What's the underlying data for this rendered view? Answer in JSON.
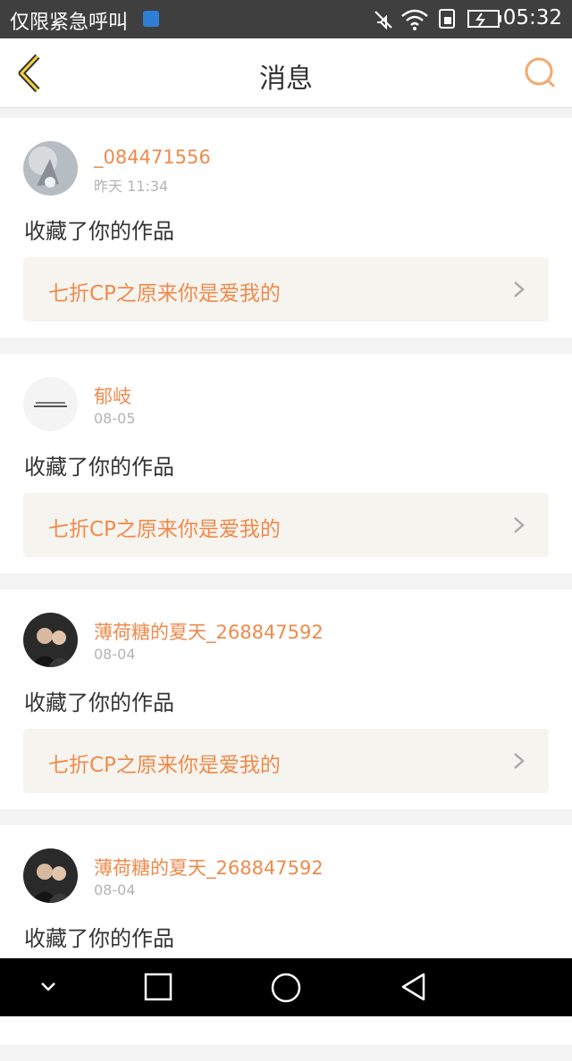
{
  "status_bar": {
    "carrier": "仅限紧急呼叫",
    "time": "05:32"
  },
  "header": {
    "title": "消息"
  },
  "messages": [
    {
      "user": "_084471556",
      "time": "昨天 11:34",
      "action": "收藏了你的作品",
      "work_title": "七折CP之原来你是爱我的"
    },
    {
      "user": "郁岐",
      "time": "08-05",
      "action": "收藏了你的作品",
      "work_title": "七折CP之原来你是爱我的"
    },
    {
      "user": "薄荷糖的夏天_268847592",
      "time": "08-04",
      "action": "收藏了你的作品",
      "work_title": "七折CP之原来你是爱我的"
    },
    {
      "user": "薄荷糖的夏天_268847592",
      "time": "08-04",
      "action": "收藏了你的作品",
      "work_title": ""
    }
  ],
  "colors": {
    "accent": "#f08a4b",
    "status_bar": "#3f3f3f",
    "card_bg": "#ffffff",
    "work_bg": "#f5f4ef",
    "page_bg": "#f3f3f3"
  }
}
